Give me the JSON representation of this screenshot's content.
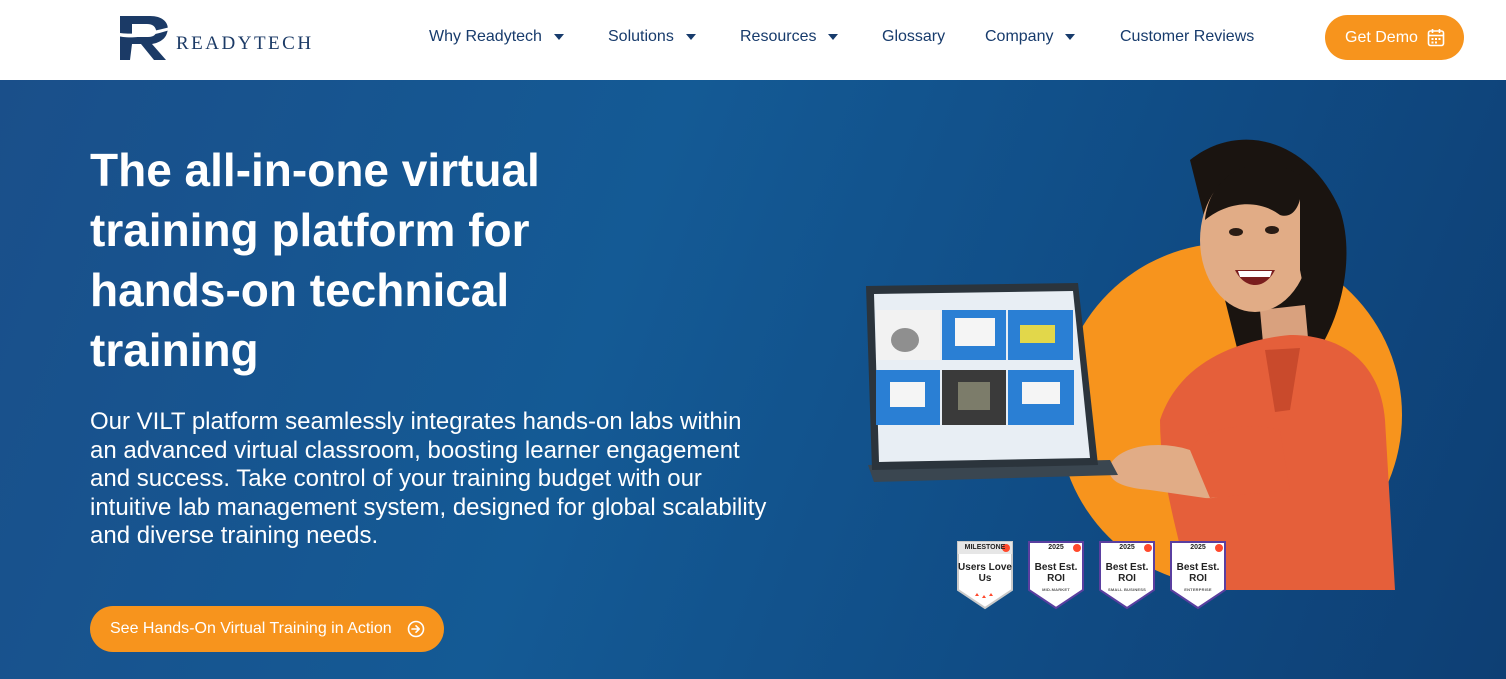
{
  "brand": {
    "logo_letter": "R",
    "logo_word": "READYTECH",
    "accent": "#f7941d",
    "navy": "#173b6c"
  },
  "nav": {
    "items": [
      {
        "label": "Why Readytech",
        "dropdown": true
      },
      {
        "label": "Solutions",
        "dropdown": true
      },
      {
        "label": "Resources",
        "dropdown": true
      },
      {
        "label": "Glossary",
        "dropdown": false
      },
      {
        "label": "Company",
        "dropdown": true
      },
      {
        "label": "Customer Reviews",
        "dropdown": false
      }
    ],
    "demo_label": "Get Demo",
    "demo_icon": "calendar-icon"
  },
  "hero": {
    "title": "The all-in-one virtual training platform for hands-on technical training",
    "description": "Our VILT platform seamlessly integrates hands-on labs within an advanced virtual classroom, boosting learner engagement and success. Take control of your training budget with our intuitive lab management system, designed for global scalability and diverse training needs.",
    "cta_label": "See Hands-On Virtual Training in Action",
    "cta_icon": "arrow-circle-right-icon",
    "background": "#145a95"
  },
  "badges": [
    {
      "top": "MILESTONE",
      "main": "Users Love Us",
      "sub": ""
    },
    {
      "top": "2025",
      "main": "Best Est. ROI",
      "sub": "MID-MARKET"
    },
    {
      "top": "2025",
      "main": "Best Est. ROI",
      "sub": "SMALL BUSINESS"
    },
    {
      "top": "2025",
      "main": "Best Est. ROI",
      "sub": "ENTERPRISE"
    }
  ]
}
